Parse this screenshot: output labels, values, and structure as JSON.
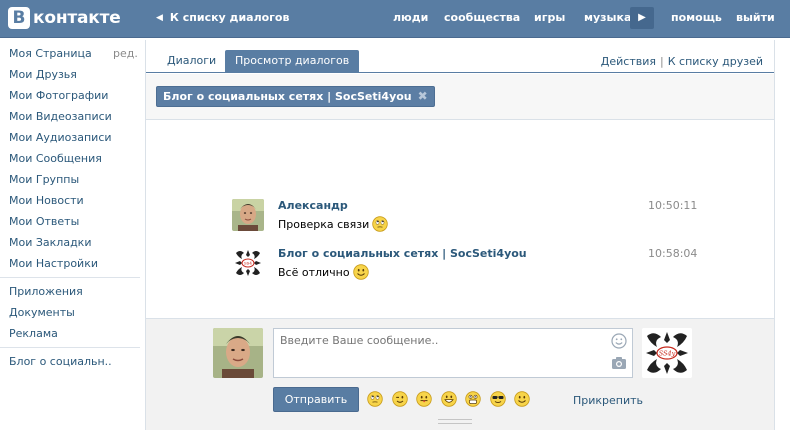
{
  "header": {
    "logo_letter": "В",
    "logo_text": "контакте",
    "back_label": "К списку диалогов",
    "nav": [
      "люди",
      "сообщества",
      "игры",
      "музыка",
      "помощь",
      "выйти"
    ],
    "accent": "#597da3"
  },
  "sidebar": {
    "edit_label": "ред.",
    "items": [
      {
        "label": "Моя Страница"
      },
      {
        "label": "Мои Друзья"
      },
      {
        "label": "Мои Фотографии"
      },
      {
        "label": "Мои Видеозаписи"
      },
      {
        "label": "Мои Аудиозаписи"
      },
      {
        "label": "Мои Сообщения"
      },
      {
        "label": "Мои Группы"
      },
      {
        "label": "Мои Новости"
      },
      {
        "label": "Мои Ответы"
      },
      {
        "label": "Мои Закладки"
      },
      {
        "label": "Мои Настройки"
      },
      {
        "label": "Приложения"
      },
      {
        "label": "Документы"
      },
      {
        "label": "Реклама"
      },
      {
        "label": "Блог о социальн.."
      }
    ]
  },
  "tabs": {
    "items": [
      {
        "label": "Диалоги"
      },
      {
        "label": "Просмотр диалогов"
      }
    ],
    "actions_label": "Действия",
    "separator": "|",
    "friends_label": "К списку друзей"
  },
  "filter": {
    "chip_label": "Блог о социальных сетях | SocSeti4you"
  },
  "messages": [
    {
      "author": "Александр",
      "text": "Проверка связи",
      "time": "10:50:11",
      "avatar_icon": "man-avatar-icon",
      "smiley_icon": "rolling-eyes-smiley-icon"
    },
    {
      "author": "Блог о социальных сетях | SocSeti4you",
      "text": "Всё отлично",
      "time": "10:58:04",
      "avatar_icon": "ornament-logo-icon",
      "smiley_icon": "smiley-icon"
    }
  ],
  "compose": {
    "placeholder": "Введите Ваше сообщение..",
    "send_label": "Отправить",
    "attach_label": "Прикрепить",
    "emojis": [
      "rolling-eyes-icon",
      "wink-icon",
      "tongue-icon",
      "grin-icon",
      "scared-icon",
      "sunglasses-icon",
      "smile-icon"
    ]
  }
}
